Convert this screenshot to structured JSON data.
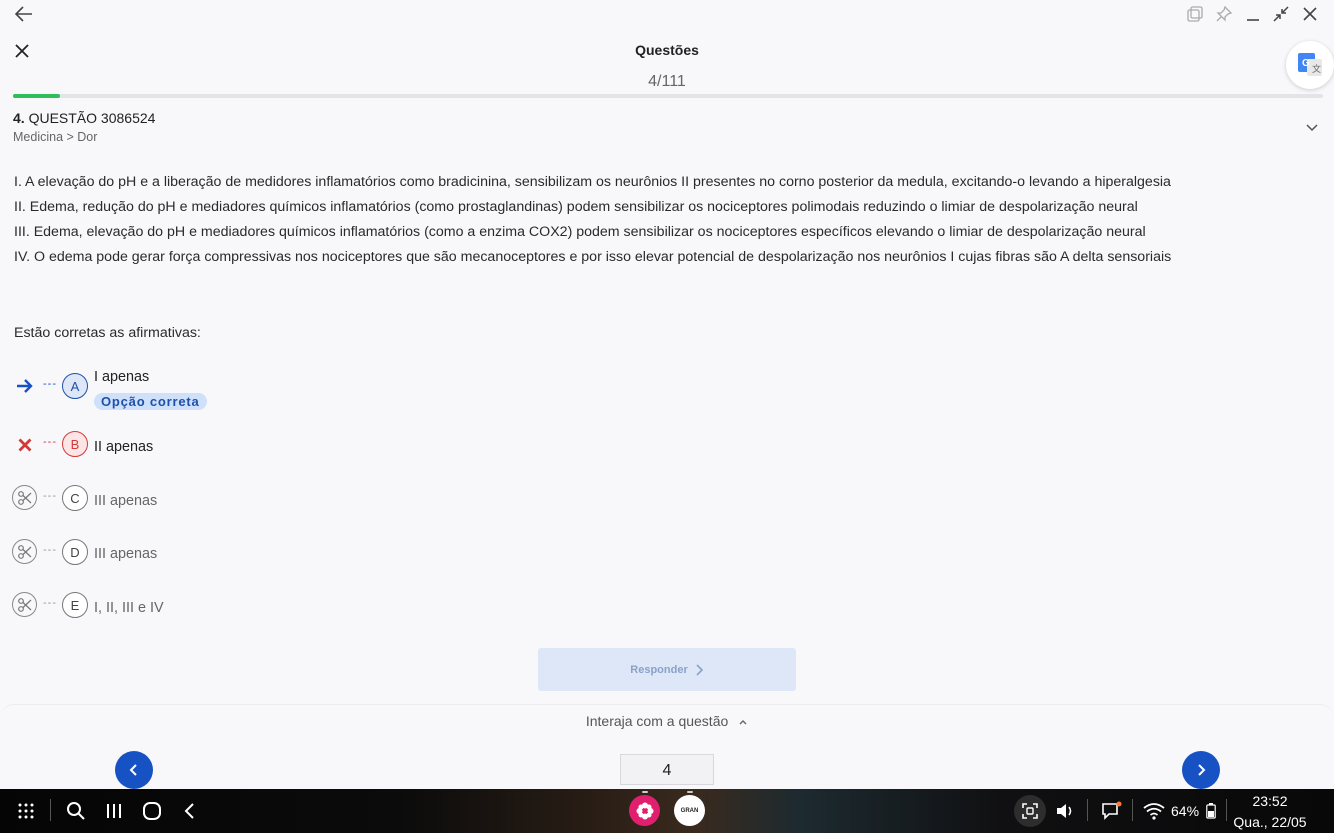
{
  "header": {
    "title": "Questões",
    "counter": "4/111",
    "progress_fraction": 0.036
  },
  "question": {
    "number": "4.",
    "code": "QUESTÃO 3086524",
    "breadcrumb": "Medicina > Dor",
    "statements": [
      "I. A elevação do pH e a liberação de medidores inflamatórios como bradicinina, sensibilizam os neurônios II presentes no corno posterior da medula, excitando-o levando a hiperalgesia",
      "II. Edema, redução do pH e mediadores químicos inflamatórios (como prostaglandinas) podem sensibilizar os nociceptores polimodais reduzindo o limiar de despolarização neural",
      "III. Edema, elevação do pH e mediadores químicos inflamatórios (como a enzima COX2) podem sensibilizar os nociceptores específicos elevando o limiar de despolarização neural",
      "IV. O edema pode gerar força compressivas nos nociceptores que são mecanoceptores e por isso elevar potencial de despolarização nos neurônios I cujas fibras são A delta sensoriais"
    ],
    "prompt": "Estão corretas as afirmativas:"
  },
  "options": [
    {
      "letter": "A",
      "text": "I apenas",
      "status": "correct-arrow"
    },
    {
      "letter": "B",
      "text": "II apenas",
      "status": "wrong"
    },
    {
      "letter": "C",
      "text": "III apenas",
      "status": "scissor"
    },
    {
      "letter": "D",
      "text": "III apenas",
      "status": "scissor"
    },
    {
      "letter": "E",
      "text": "I, II, III e IV",
      "status": "scissor"
    }
  ],
  "correct_badge": "Opção correta",
  "responder_label": "Responder",
  "interaja_label": "Interaja com a questão",
  "page_input_value": "4",
  "gran_app_label": "GRAN",
  "taskbar": {
    "battery": "64%",
    "time": "23:52",
    "date": "Qua., 22/05"
  },
  "colors": {
    "accent": "#1652c4",
    "progress": "#2ebd59",
    "wrong": "#d23a3a",
    "badge_bg": "#cfe0fb"
  }
}
